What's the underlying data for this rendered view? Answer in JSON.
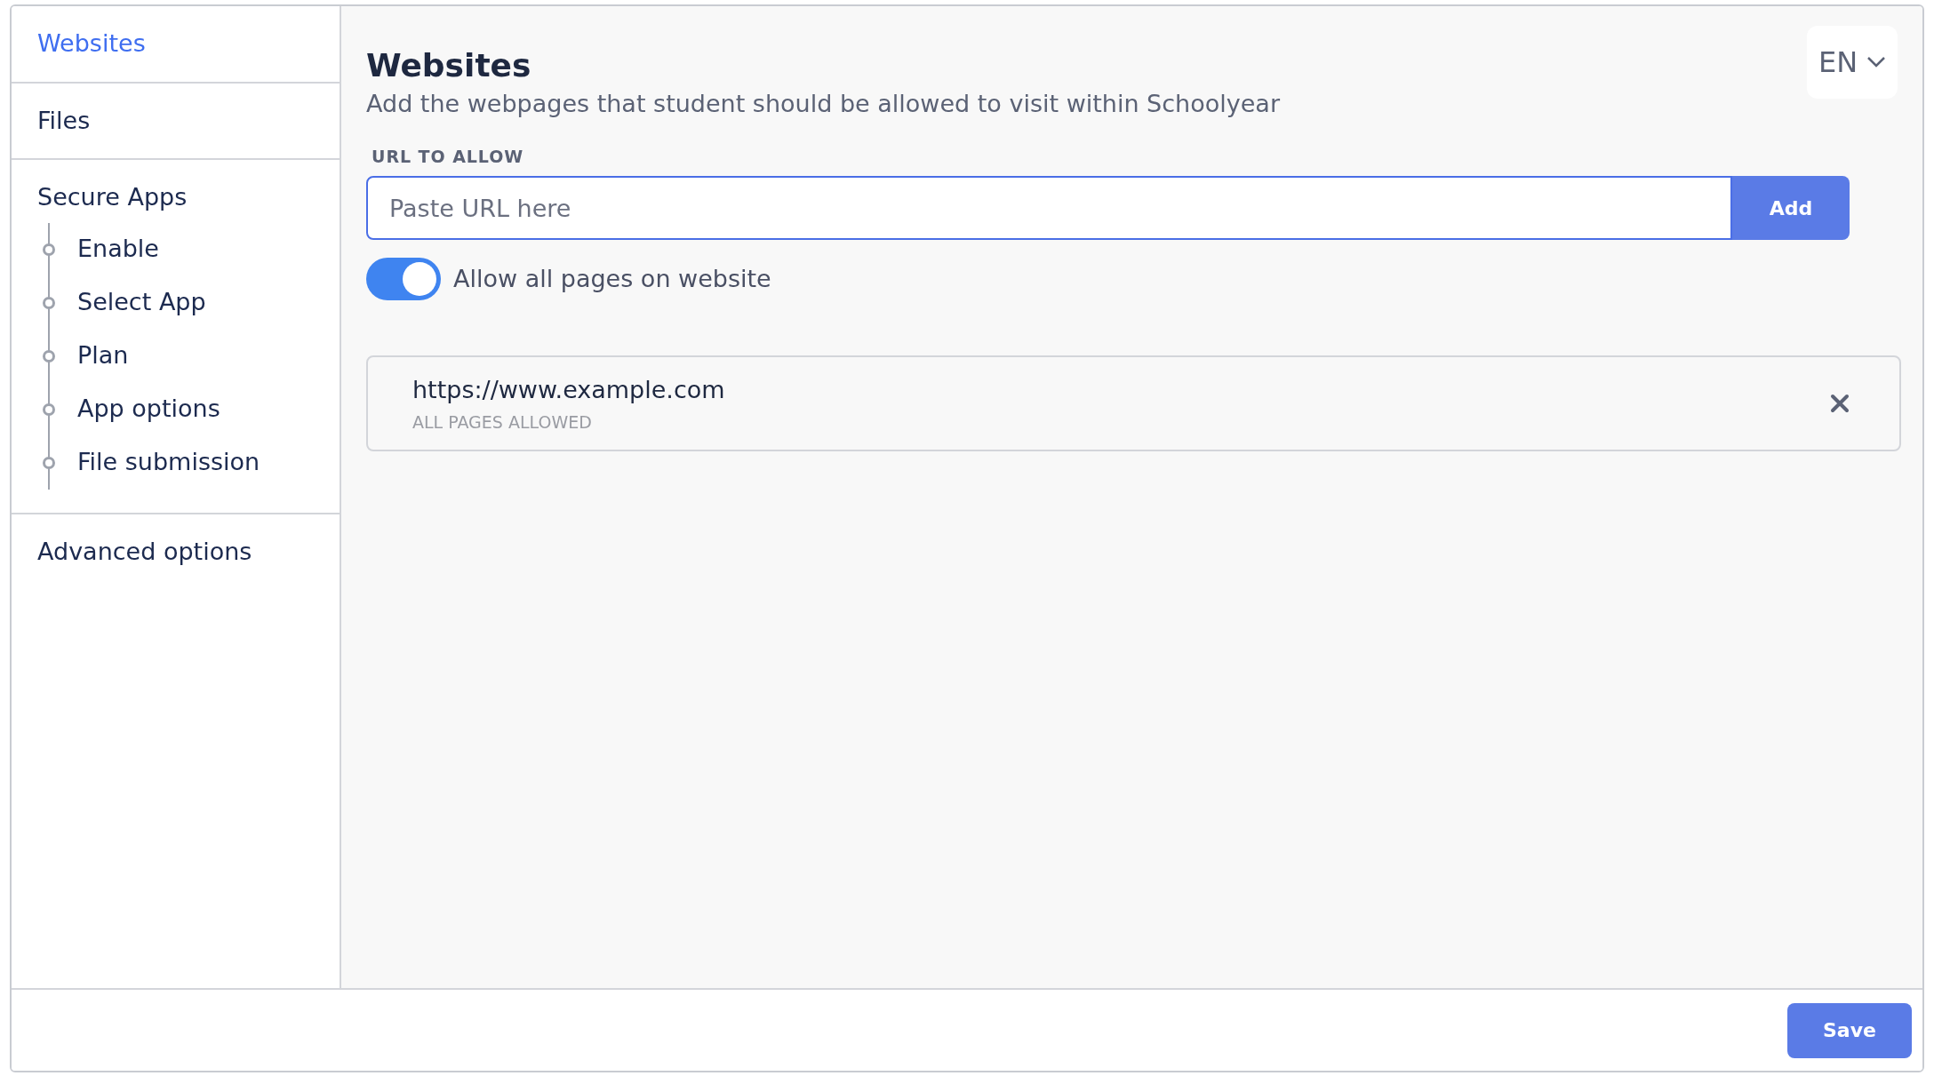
{
  "sidebar": {
    "sections": [
      {
        "label": "Websites",
        "selected": true
      },
      {
        "label": "Files",
        "selected": false
      },
      {
        "label": "Secure Apps",
        "selected": false,
        "children": [
          {
            "label": "Enable",
            "selected": false
          },
          {
            "label": "Select App",
            "selected": false
          },
          {
            "label": "Plan",
            "selected": false
          },
          {
            "label": "App options",
            "selected": false
          },
          {
            "label": "File submission",
            "selected": false
          }
        ]
      },
      {
        "label": "Advanced options",
        "selected": false
      }
    ]
  },
  "main": {
    "title": "Websites",
    "description": "Add the webpages that student should be allowed to visit within Schoolyear",
    "language": "EN",
    "url_field": {
      "label": "URL TO ALLOW",
      "placeholder": "Paste URL here",
      "button": "Add"
    },
    "toggle": {
      "label": "Allow all pages on website",
      "on": true
    },
    "allowed": [
      {
        "url": "https://www.example.com",
        "scope": "ALL PAGES ALLOWED"
      }
    ]
  },
  "footer": {
    "button": "Save"
  }
}
